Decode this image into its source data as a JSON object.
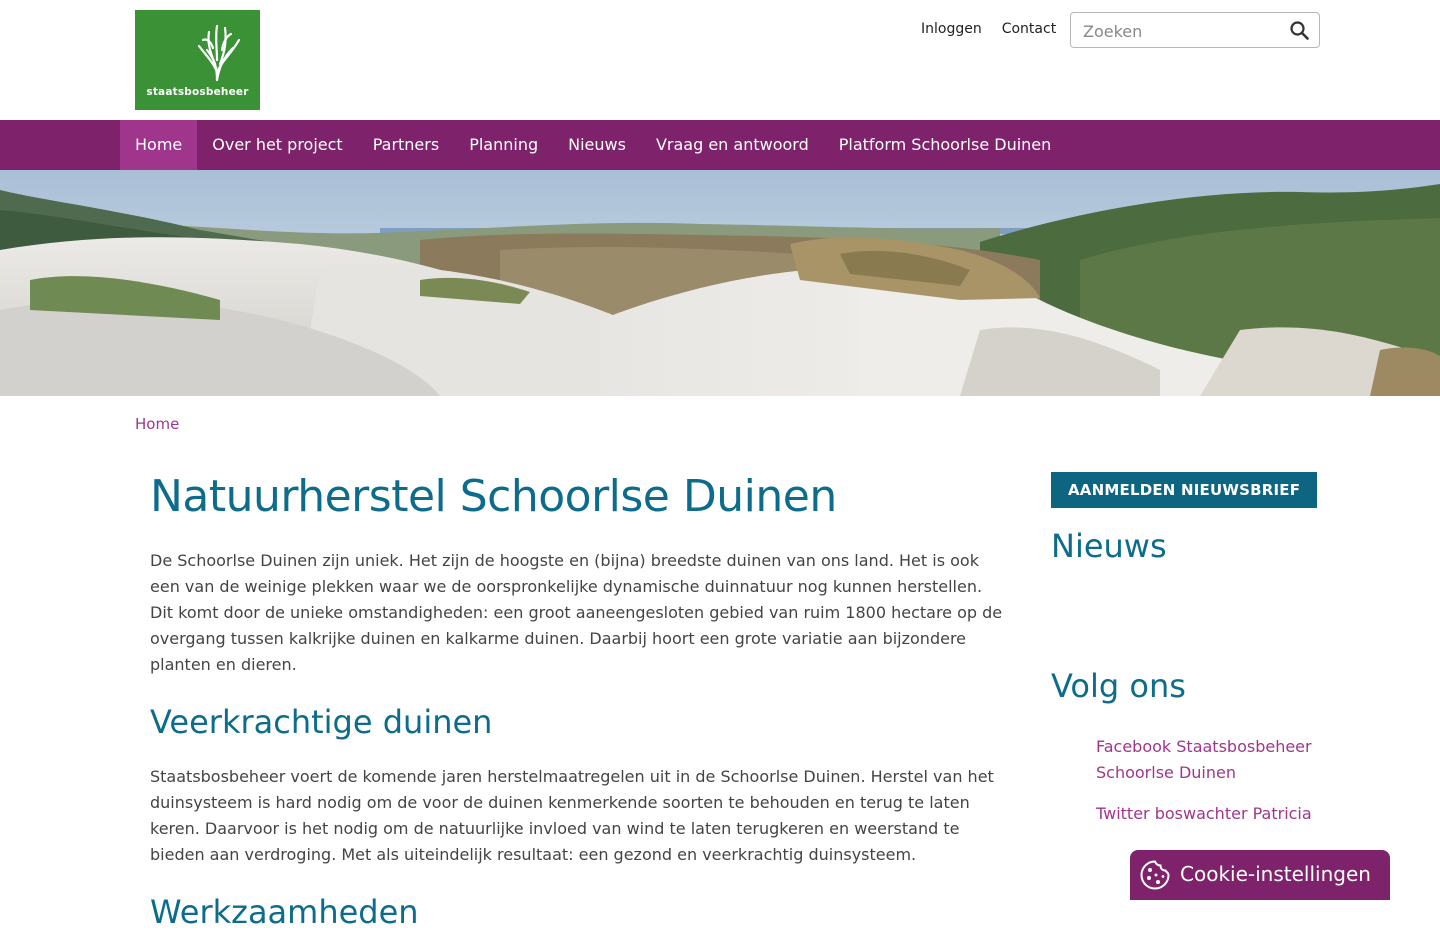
{
  "header": {
    "logo_text": "staatsbosbeheer",
    "links": [
      "Inloggen",
      "Contact"
    ],
    "search": {
      "placeholder": "Zoeken"
    }
  },
  "nav": [
    "Home",
    "Over het project",
    "Partners",
    "Planning",
    "Nieuws",
    "Vraag en antwoord",
    "Platform Schoorlse Duinen"
  ],
  "breadcrumb": "Home",
  "main": {
    "title": "Natuurherstel Schoorlse Duinen",
    "intro": "De Schoorlse Duinen zijn uniek. Het zijn de hoogste en (bijna) breedste duinen van ons land. Het is ook een van de weinige plekken waar we de oorspronkelijke dynamische duinnatuur nog kunnen herstellen. Dit komt door de unieke omstandigheden: een groot aaneengesloten gebied van ruim 1800 hectare op de overgang tussen kalkrijke duinen en kalkarme duinen. Daarbij hoort een grote variatie aan bijzondere planten en dieren.",
    "h2_1": "Veerkrachtige duinen",
    "p2": "Staatsbosbeheer voert de komende jaren herstelmaatregelen uit in de Schoorlse Duinen. Herstel van het duinsysteem is hard nodig om de voor de duinen kenmerkende soorten te behouden en terug te laten keren. Daarvoor is het nodig om de natuurlijke invloed van wind te laten terugkeren en weerstand te bieden aan verdroging. Met als uiteindelijk resultaat: een gezond en veerkrachtig duinsysteem.",
    "h2_2": "Werkzaamheden"
  },
  "sidebar": {
    "newsletter_button": "AANMELDEN NIEUWSBRIEF",
    "news_heading": "Nieuws",
    "follow_heading": "Volg ons",
    "follow_links": [
      "Facebook Staatsbosbeheer Schoorlse Duinen",
      "Twitter boswachter Patricia"
    ]
  },
  "cookie": {
    "label": "Cookie-instellingen"
  },
  "colors": {
    "brand_green": "#3a9136",
    "nav_purple": "#7e236b",
    "nav_active": "#a0368c",
    "heading_blue": "#0d6c8c",
    "link_purple": "#a0368c"
  }
}
